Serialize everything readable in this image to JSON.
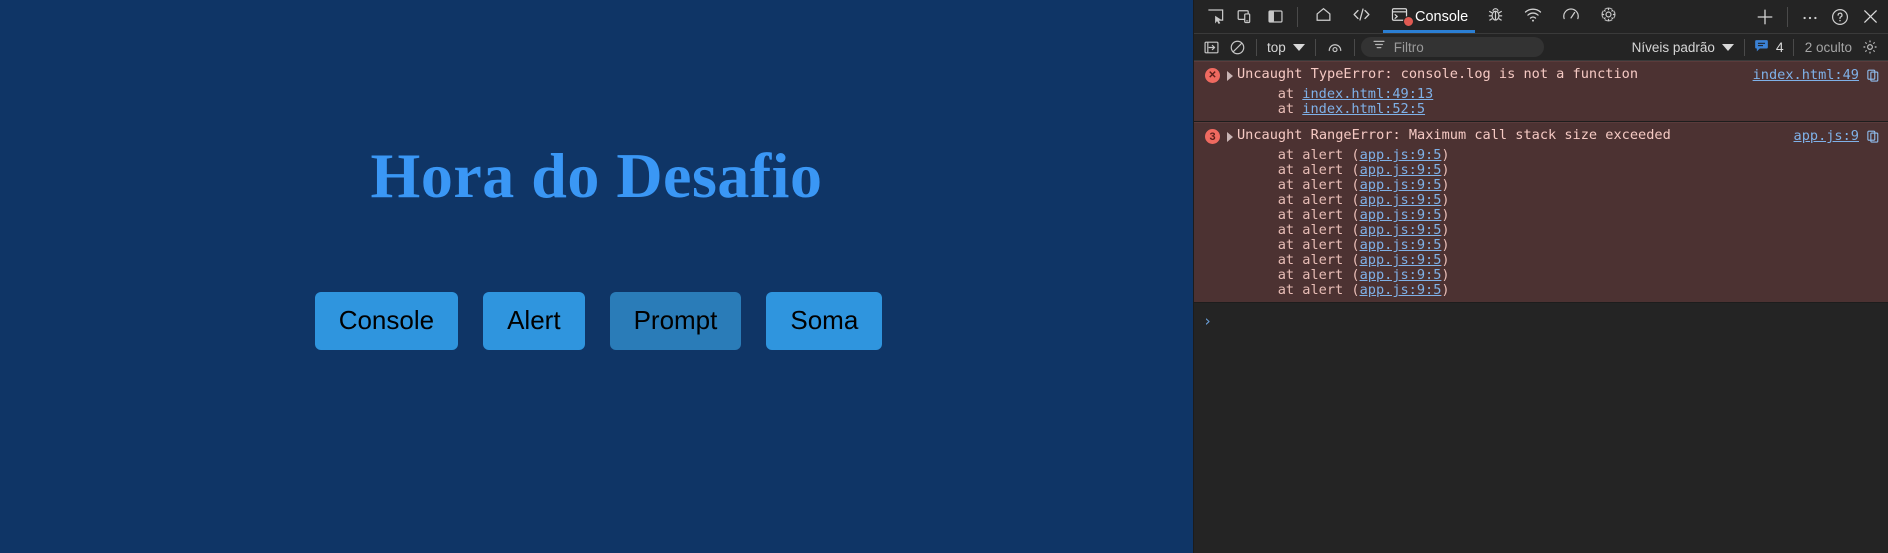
{
  "page": {
    "title": "Hora do Desafio",
    "background_color": "#0f3566",
    "title_color": "#3a97f5",
    "buttons": [
      {
        "label": "Console",
        "state": "normal"
      },
      {
        "label": "Alert",
        "state": "normal"
      },
      {
        "label": "Prompt",
        "state": "hover"
      },
      {
        "label": "Soma",
        "state": "normal"
      }
    ]
  },
  "devtools": {
    "tabbar": {
      "left_icons": [
        {
          "name": "inspect-element-icon"
        },
        {
          "name": "device-toolbar-icon"
        },
        {
          "name": "panel-layout-icon"
        }
      ],
      "tabs": [
        {
          "name": "tab-home",
          "icon": "home-icon",
          "label": "",
          "active": false
        },
        {
          "name": "tab-debugger",
          "icon": "code-icon",
          "label": "",
          "active": false
        },
        {
          "name": "tab-console",
          "icon": "console-icon",
          "label": "Console",
          "active": true,
          "error_dot": true
        },
        {
          "name": "tab-inspector",
          "icon": "bug-icon",
          "label": "",
          "active": false
        },
        {
          "name": "tab-network",
          "icon": "network-icon",
          "label": "",
          "active": false
        },
        {
          "name": "tab-performance",
          "icon": "gauge-icon",
          "label": "",
          "active": false
        },
        {
          "name": "tab-memory",
          "icon": "chip-icon",
          "label": "",
          "active": false
        }
      ],
      "right_icons": [
        {
          "name": "add-tab-icon",
          "glyph": "+"
        },
        {
          "name": "more-options-icon",
          "glyph": "…"
        },
        {
          "name": "help-icon",
          "glyph": "?"
        },
        {
          "name": "close-icon",
          "glyph": "✕"
        }
      ]
    },
    "filterbar": {
      "split_console_icon": "split-console-icon",
      "clear_console_icon": "clear-console-icon",
      "context_selector": "top",
      "eye_icon": "live-expression-icon",
      "filter_icon": "filter-icon",
      "filter_value": "",
      "filter_placeholder": "Filtro",
      "levels_selector": "Níveis padrão",
      "issues_icon": "issues-icon",
      "issues_count": "4",
      "hidden_count_label": "2 oculto",
      "settings_icon": "gear-icon"
    },
    "console": {
      "entries": [
        {
          "badge": "✕",
          "badge_kind": "x",
          "message": "Uncaught TypeError: console.log is not a function",
          "source": "index.html:49",
          "stack": [
            {
              "prefix": "    at ",
              "link": "index.html:49:13",
              "suffix": ""
            },
            {
              "prefix": "    at ",
              "link": "index.html:52:5",
              "suffix": ""
            }
          ]
        },
        {
          "badge": "3",
          "badge_kind": "count",
          "message": "Uncaught RangeError: Maximum call stack size exceeded",
          "source": "app.js:9",
          "stack": [
            {
              "prefix": "    at alert (",
              "link": "app.js:9:5",
              "suffix": ")"
            },
            {
              "prefix": "    at alert (",
              "link": "app.js:9:5",
              "suffix": ")"
            },
            {
              "prefix": "    at alert (",
              "link": "app.js:9:5",
              "suffix": ")"
            },
            {
              "prefix": "    at alert (",
              "link": "app.js:9:5",
              "suffix": ")"
            },
            {
              "prefix": "    at alert (",
              "link": "app.js:9:5",
              "suffix": ")"
            },
            {
              "prefix": "    at alert (",
              "link": "app.js:9:5",
              "suffix": ")"
            },
            {
              "prefix": "    at alert (",
              "link": "app.js:9:5",
              "suffix": ")"
            },
            {
              "prefix": "    at alert (",
              "link": "app.js:9:5",
              "suffix": ")"
            },
            {
              "prefix": "    at alert (",
              "link": "app.js:9:5",
              "suffix": ")"
            },
            {
              "prefix": "    at alert (",
              "link": "app.js:9:5",
              "suffix": ")"
            }
          ]
        }
      ],
      "prompt_caret": "›",
      "prompt_value": ""
    }
  }
}
